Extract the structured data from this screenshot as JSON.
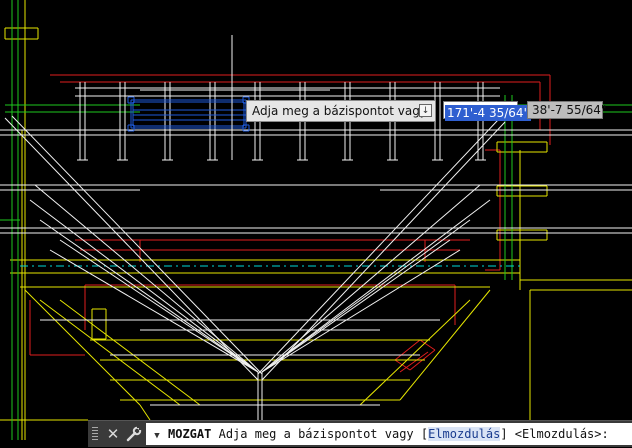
{
  "drawing": {
    "colors": {
      "background": "#000000",
      "white": "#f2f2f2",
      "red": "#e01e1e",
      "yellow": "#e6e600",
      "green": "#1ec81e",
      "cyan": "#00d7d7",
      "selection": "#1e5adc"
    }
  },
  "dynamic_input": {
    "prompt": "Adja meg a bázispontot vagy",
    "x_value": "171'-4 35/64\"",
    "y_value": "38'-7 55/64\""
  },
  "command_line": {
    "close_icon": "close-icon",
    "settings_icon": "wrench-icon",
    "command": "MOZGAT",
    "prompt_prefix": "Adja meg a bázispontot vagy [",
    "option": "Elmozdulás",
    "prompt_suffix": "] <Elmozdulás>:"
  }
}
